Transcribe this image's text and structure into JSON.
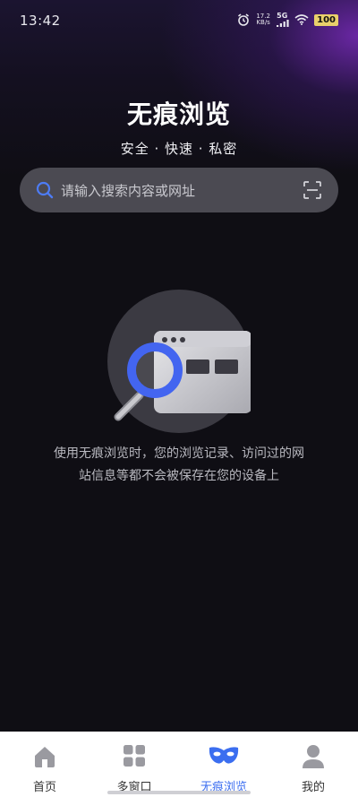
{
  "status_bar": {
    "time": "13:42",
    "speed_value": "17.2",
    "speed_unit": "KB/s",
    "network": "5G",
    "battery": "100"
  },
  "header": {
    "title": "无痕浏览",
    "subtitle": "安全 · 快速 · 私密"
  },
  "search": {
    "placeholder": "请输入搜索内容或网址",
    "value": ""
  },
  "illustration": {
    "icon": "incognito-browser-illustration"
  },
  "description": {
    "line1": "使用无痕浏览时，您的浏览记录、访问过的网",
    "line2": "站信息等都不会被保存在您的设备上"
  },
  "bottom_nav": {
    "active_index": 2,
    "accent_color": "#3b6ef0",
    "items": [
      {
        "label": "首页",
        "icon": "home-icon"
      },
      {
        "label": "多窗口",
        "icon": "windows-grid-icon"
      },
      {
        "label": "无痕浏览",
        "icon": "mask-icon"
      },
      {
        "label": "我的",
        "icon": "user-icon"
      }
    ]
  }
}
